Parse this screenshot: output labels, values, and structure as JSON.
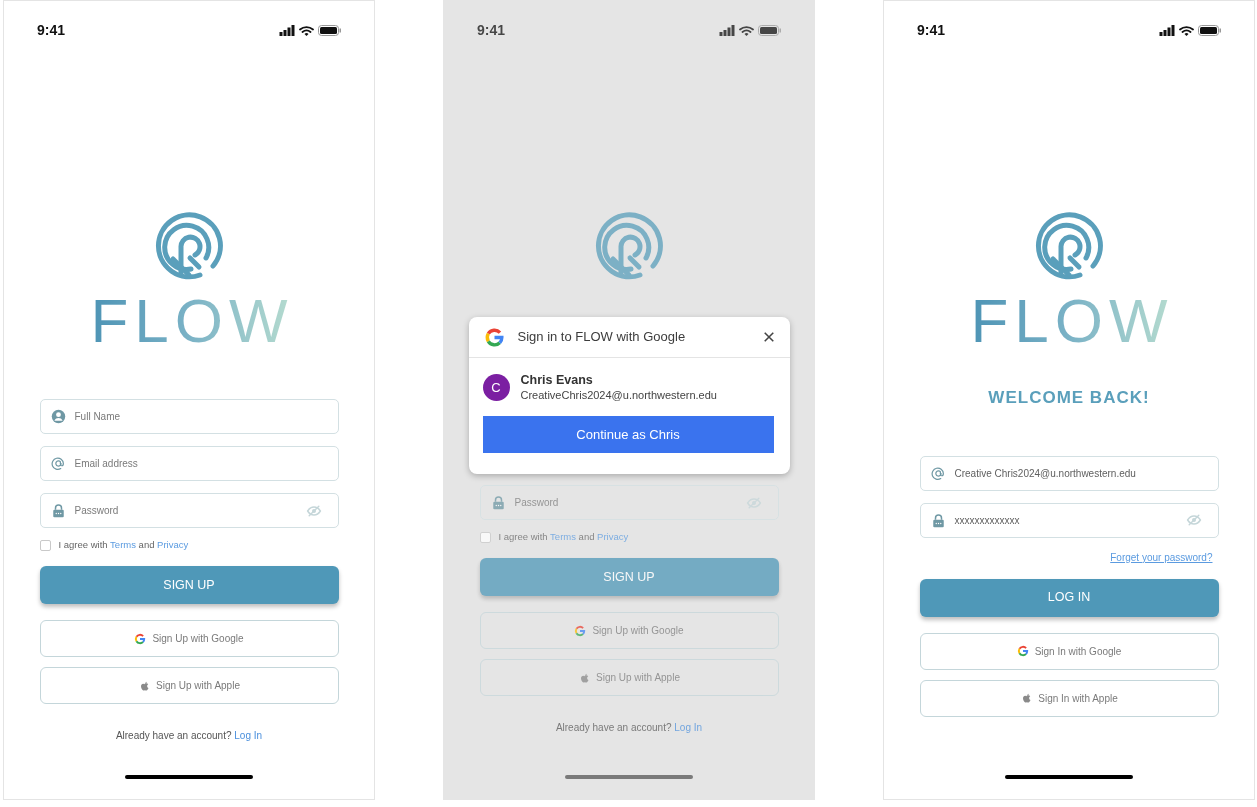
{
  "screens": [
    {
      "dimmed": false,
      "status_bar": {
        "time": "9:41"
      },
      "logo": {
        "wordmark": "FLOW"
      },
      "fields": [
        {
          "kind": "name",
          "placeholder": "Full Name"
        },
        {
          "kind": "email",
          "placeholder": "Email address"
        },
        {
          "kind": "password",
          "placeholder": "Password"
        }
      ],
      "agreement": {
        "checked": false,
        "segments": [
          {
            "kind": "text",
            "text": "I agree with"
          },
          {
            "kind": "link",
            "text": "Terms"
          },
          {
            "kind": "text",
            "text": "and"
          },
          {
            "kind": "link",
            "text": "Privacy"
          }
        ]
      },
      "primary_button": {
        "label": "SIGN UP"
      },
      "social_buttons": [
        {
          "kind": "google",
          "label": "Sign Up with Google"
        },
        {
          "kind": "apple",
          "label": "Sign Up with Apple"
        }
      ],
      "footer": {
        "text": "Already have an account?",
        "link": "Log In"
      }
    },
    {
      "dimmed": true,
      "status_bar": {
        "time": "9:41"
      },
      "dialog": {
        "title": "Sign in to FLOW with Google",
        "account": {
          "initial": "C",
          "name": "Chris Evans",
          "email": "CreativeChris2024@u.northwestern.edu"
        },
        "button": "Continue as Chris"
      },
      "fields": [
        {
          "kind": "password",
          "placeholder": "Password"
        }
      ],
      "agreement": {
        "checked": false,
        "segments": [
          {
            "kind": "text",
            "text": "I agree with"
          },
          {
            "kind": "link",
            "text": "Terms"
          },
          {
            "kind": "text",
            "text": "and"
          },
          {
            "kind": "link",
            "text": "Privacy"
          }
        ]
      },
      "primary_button": {
        "label": "SIGN UP"
      },
      "social_buttons": [
        {
          "kind": "google",
          "label": "Sign Up with Google"
        },
        {
          "kind": "apple",
          "label": "Sign Up with Apple"
        }
      ],
      "footer": {
        "text": "Already have an account?",
        "link": "Log In"
      }
    },
    {
      "dimmed": false,
      "status_bar": {
        "time": "9:41"
      },
      "logo": {
        "wordmark": "FLOW"
      },
      "heading": "WELCOME BACK!",
      "fields": [
        {
          "kind": "email",
          "value": "Creative Chris2024@u.northwestern.edu"
        },
        {
          "kind": "password",
          "value": "xxxxxxxxxxxxx"
        }
      ],
      "forgot_link": "Forget your password?",
      "primary_button": {
        "label": "LOG IN"
      },
      "social_buttons": [
        {
          "kind": "google",
          "label": "Sign In with Google"
        },
        {
          "kind": "apple",
          "label": "Sign In with Apple"
        }
      ]
    }
  ]
}
